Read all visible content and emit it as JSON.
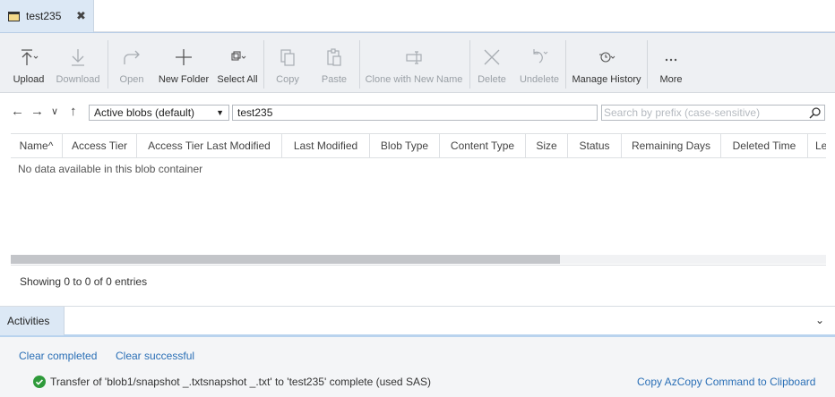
{
  "tab": {
    "title": "test235",
    "close": "✖"
  },
  "toolbar": {
    "upload": "Upload",
    "download": "Download",
    "open": "Open",
    "new_folder": "New Folder",
    "select_all": "Select All",
    "copy": "Copy",
    "paste": "Paste",
    "clone": "Clone with New Name",
    "delete": "Delete",
    "undelete": "Undelete",
    "manage_history": "Manage History",
    "more": "More"
  },
  "nav": {
    "view_selected": "Active blobs (default)",
    "path": "test235",
    "search_placeholder": "Search by prefix (case-sensitive)"
  },
  "table": {
    "columns": [
      "Name",
      "Access Tier",
      "Access Tier Last Modified",
      "Last Modified",
      "Blob Type",
      "Content Type",
      "Size",
      "Status",
      "Remaining Days",
      "Deleted Time",
      "Le"
    ],
    "empty_message": "No data available in this blob container"
  },
  "footer": {
    "entries": "Showing 0 to 0 of 0 entries"
  },
  "activities": {
    "tab_label": "Activities",
    "clear_completed": "Clear completed",
    "clear_successful": "Clear successful",
    "message": "Transfer of 'blob1/snapshot _.txtsnapshot _.txt' to 'test235' complete (used SAS)",
    "copy_command": "Copy AzCopy Command to Clipboard"
  },
  "colors": {
    "accent": "#2a6fb6",
    "tab_bg": "#dce8f5",
    "success": "#2e9a3a"
  }
}
